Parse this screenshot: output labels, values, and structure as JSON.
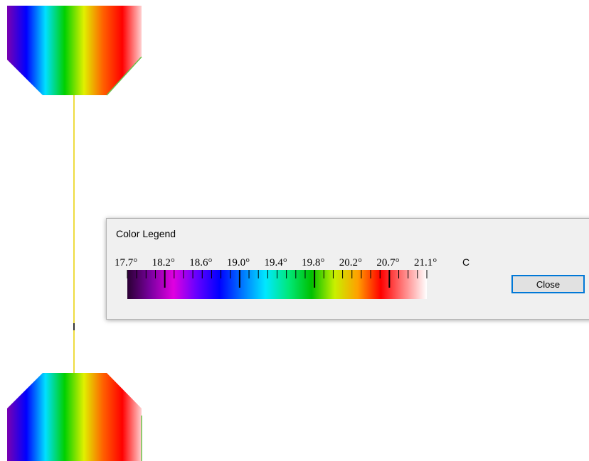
{
  "dialog": {
    "title": "Color Legend",
    "close_label": "Close"
  },
  "legend": {
    "tick_labels": [
      "17.7°",
      "18.2°",
      "18.6°",
      "19.0°",
      "19.4°",
      "19.8°",
      "20.2°",
      "20.7°",
      "21.1°"
    ],
    "unit": "C",
    "colors": [
      "#2a0033",
      "#7a00a0",
      "#e000e0",
      "#6600ff",
      "#0000ff",
      "#0077ff",
      "#00e8ff",
      "#00e87a",
      "#00c000",
      "#c8f000",
      "#ffa000",
      "#ff0000",
      "#ff8080",
      "#ffffff"
    ]
  },
  "model": {
    "colors": [
      "#7a00b0",
      "#0000ff",
      "#00e0ff",
      "#00d000",
      "#e0f000",
      "#ff6000",
      "#ff0000",
      "#ffd0d0"
    ],
    "edge_color": "#6cc04a",
    "wire_color": "#e8d000"
  }
}
